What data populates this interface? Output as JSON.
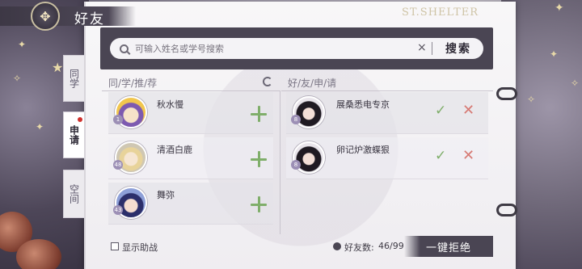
{
  "header": {
    "title": "好友",
    "brand": "ST.SHELTER",
    "emblem_icon": "winged-emblem-icon"
  },
  "side_tabs": [
    {
      "label": "同学",
      "active": false
    },
    {
      "label": "申请",
      "active": true,
      "notification": true
    },
    {
      "label": "空间",
      "active": false
    }
  ],
  "search": {
    "placeholder": "可输入姓名或学号搜索",
    "clear_icon": "×",
    "button_label": "搜索"
  },
  "recommend": {
    "title": "同/学/推/荐",
    "items": [
      {
        "name": "秋水慢",
        "level": "1"
      },
      {
        "name": "清酒白鹿",
        "level": "48"
      },
      {
        "name": "舞弥",
        "level": "43"
      }
    ]
  },
  "requests": {
    "title": "好/友/申/请",
    "items": [
      {
        "name": "展桑悉电专京",
        "level": "8"
      },
      {
        "name": "卵记炉激蝶狠",
        "level": "8"
      }
    ]
  },
  "footer": {
    "show_assist_label": "显示助战",
    "friend_count_label": "好友数:",
    "friend_count_value": "46/99",
    "reject_all_label": "一键拒绝"
  },
  "colors": {
    "accent_green": "#7fae6a",
    "reject_red": "#d77a74",
    "dark_bar": "#4a4553",
    "notify_dot": "#d0312d"
  }
}
